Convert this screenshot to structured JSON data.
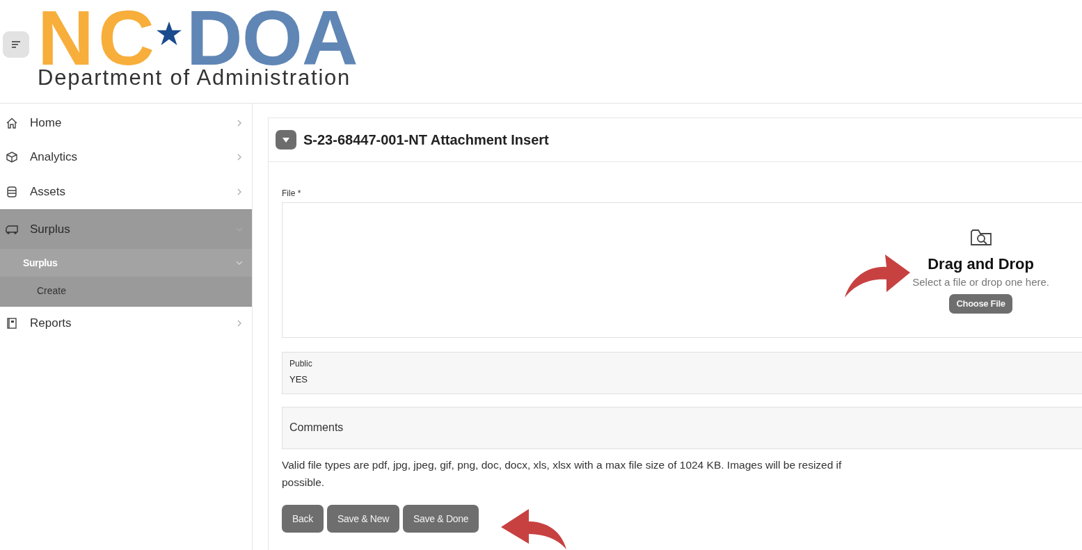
{
  "header": {
    "logo": {
      "left": "NC",
      "right": "DOA",
      "subtitle": "Department of Administration"
    }
  },
  "sidebar": {
    "items": [
      {
        "label": "Home",
        "expanded": false
      },
      {
        "label": "Analytics",
        "expanded": false
      },
      {
        "label": "Assets",
        "expanded": false
      },
      {
        "label": "Surplus",
        "expanded": true,
        "children": [
          {
            "label": "Surplus",
            "expanded": true,
            "children": [
              {
                "label": "Create"
              }
            ]
          }
        ]
      },
      {
        "label": "Reports",
        "expanded": false
      }
    ]
  },
  "region": {
    "title": "S-23-68447-001-NT Attachment Insert",
    "expanded": true,
    "file_field": {
      "label": "File *",
      "drop_title": "Drag and Drop",
      "drop_hint": "Select a file or drop one here.",
      "button": "Choose File"
    },
    "public_field": {
      "label": "Public",
      "value": "YES"
    },
    "comments_field": {
      "placeholder": "Comments"
    },
    "help_text": "Valid file types are pdf, jpg, jpeg, gif, png, doc, docx, xls, xlsx with a max file size of 1024 KB. Images will be resized if possible.",
    "buttons": [
      "Back",
      "Save & New",
      "Save & Done"
    ]
  },
  "callouts": [
    {
      "kind": "arrow-right"
    },
    {
      "kind": "arrow-left"
    }
  ]
}
